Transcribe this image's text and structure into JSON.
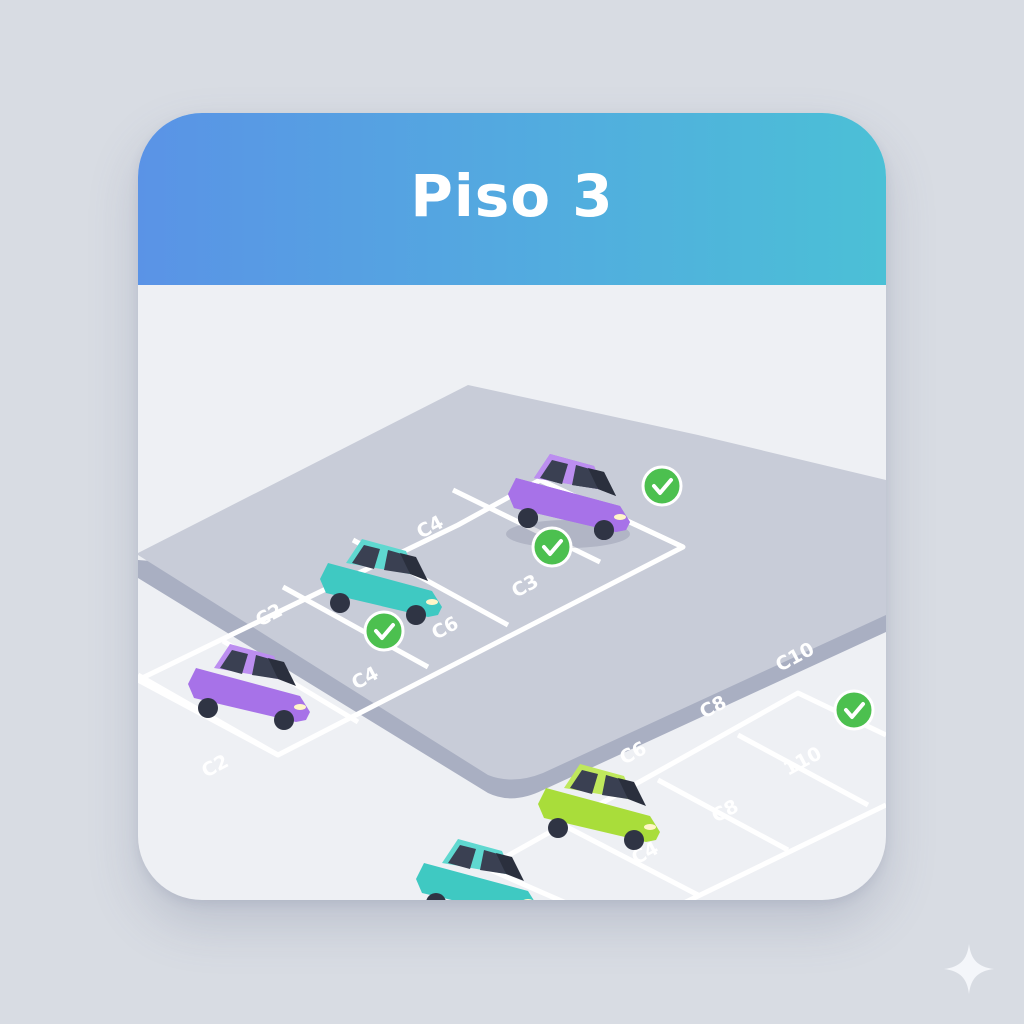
{
  "floor": {
    "title": "Piso 3"
  },
  "spots": {
    "top_a": "C4",
    "top_b": "C3",
    "top_c": "C2",
    "top_d": "C6",
    "top_e": "C4",
    "top_f": "C2",
    "bottom_a": "C10",
    "bottom_b": "C8",
    "bottom_c": "C6",
    "bottom_d": "110",
    "bottom_e": "C8",
    "bottom_f": "C4"
  },
  "colors": {
    "header_start": "#5a93e6",
    "header_end": "#4bc0d6",
    "car_purple": "#a772e8",
    "car_teal": "#3fc9c2",
    "car_lime": "#a9dd3a",
    "check_green": "#4cc04f"
  },
  "icons": [
    "check-icon",
    "car-icon",
    "sparkle-icon"
  ]
}
